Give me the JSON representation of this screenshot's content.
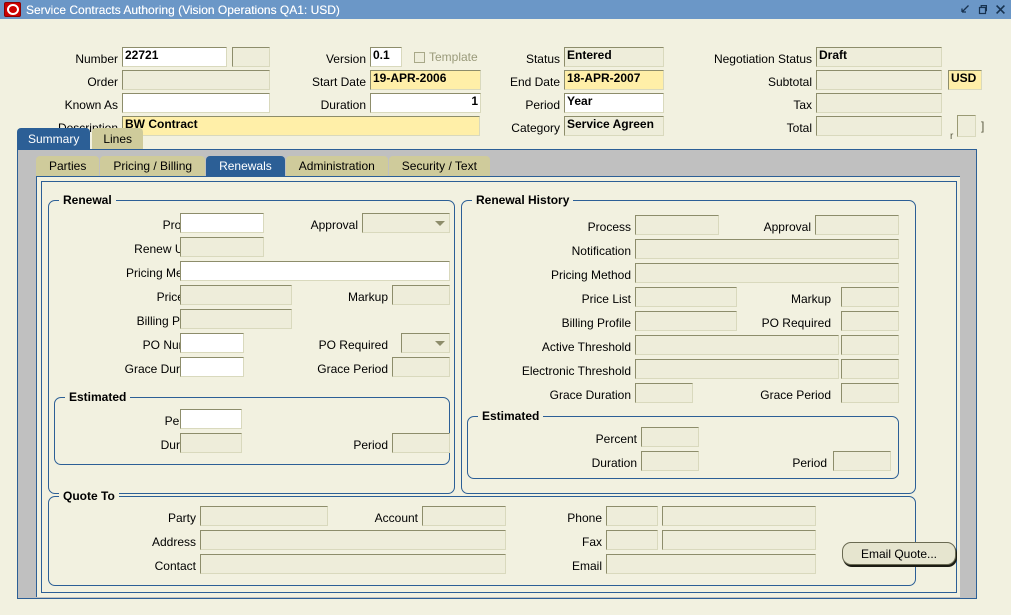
{
  "window": {
    "title": "Service Contracts Authoring (Vision Operations QA1: USD)",
    "logo_icon": "oracle-logo-icon",
    "controls": [
      {
        "name": "minimize-button",
        "icon": "minimize-icon"
      },
      {
        "name": "restore-button",
        "icon": "restore-icon"
      },
      {
        "name": "close-button",
        "icon": "close-icon"
      }
    ]
  },
  "header": {
    "number": {
      "label": "Number",
      "value": "22721"
    },
    "number_extra": {
      "label": "",
      "value": ""
    },
    "order": {
      "label": "Order",
      "value": ""
    },
    "known_as": {
      "label": "Known As",
      "value": ""
    },
    "description": {
      "label": "Description",
      "value": "BW Contract"
    },
    "version": {
      "label": "Version",
      "value": "0.1"
    },
    "template": {
      "label": "Template",
      "checked": false
    },
    "start_date": {
      "label": "Start Date",
      "value": "19-APR-2006"
    },
    "duration": {
      "label": "Duration",
      "value": "1"
    },
    "status": {
      "label": "Status",
      "value": "Entered"
    },
    "end_date": {
      "label": "End Date",
      "value": "18-APR-2007"
    },
    "period": {
      "label": "Period",
      "value": "Year"
    },
    "category": {
      "label": "Category",
      "value": "Service Agreen"
    },
    "negotiation_status": {
      "label": "Negotiation Status",
      "value": "Draft"
    },
    "subtotal": {
      "label": "Subtotal",
      "value": ""
    },
    "currency": {
      "label": "",
      "value": "USD"
    },
    "tax": {
      "label": "Tax",
      "value": ""
    },
    "total": {
      "label": "Total",
      "value": ""
    },
    "total_bracket_right": "]",
    "total_bracket_left": "r"
  },
  "tabs_primary": [
    {
      "label": "Summary",
      "selected": true
    },
    {
      "label": "Lines",
      "selected": false
    }
  ],
  "tabs_secondary": [
    {
      "label": "Parties",
      "selected": false
    },
    {
      "label": "Pricing / Billing",
      "selected": false
    },
    {
      "label": "Renewals",
      "selected": true
    },
    {
      "label": "Administration",
      "selected": false
    },
    {
      "label": "Security / Text",
      "selected": false
    }
  ],
  "renewal": {
    "title": "Renewal",
    "process": {
      "label": "Process",
      "value": ""
    },
    "approval": {
      "label": "Approval",
      "value": ""
    },
    "renew_up_to": {
      "label": "Renew Up To",
      "value": ""
    },
    "pricing_method": {
      "label": "Pricing Method",
      "value": ""
    },
    "price_list": {
      "label": "Price List",
      "value": ""
    },
    "markup": {
      "label": "Markup",
      "value": ""
    },
    "billing_profile": {
      "label": "Billing Profile",
      "value": ""
    },
    "po_number": {
      "label": "PO Number",
      "value": ""
    },
    "po_required": {
      "label": "PO Required",
      "value": ""
    },
    "grace_duration": {
      "label": "Grace Duration",
      "value": ""
    },
    "grace_period": {
      "label": "Grace Period",
      "value": ""
    },
    "estimated": {
      "title": "Estimated",
      "percent": {
        "label": "Percent",
        "value": ""
      },
      "duration": {
        "label": "Duration",
        "value": ""
      },
      "period": {
        "label": "Period",
        "value": ""
      }
    }
  },
  "renewal_history": {
    "title": "Renewal History",
    "process": {
      "label": "Process",
      "value": ""
    },
    "approval": {
      "label": "Approval",
      "value": ""
    },
    "notification": {
      "label": "Notification",
      "value": ""
    },
    "pricing_method": {
      "label": "Pricing Method",
      "value": ""
    },
    "price_list": {
      "label": "Price List",
      "value": ""
    },
    "markup": {
      "label": "Markup",
      "value": ""
    },
    "billing_profile": {
      "label": "Billing Profile",
      "value": ""
    },
    "po_required": {
      "label": "PO Required",
      "value": ""
    },
    "active_threshold": {
      "label": "Active Threshold",
      "value": "",
      "value2": ""
    },
    "electronic_threshold": {
      "label": "Electronic Threshold",
      "value": "",
      "value2": ""
    },
    "grace_duration": {
      "label": "Grace Duration",
      "value": ""
    },
    "grace_period": {
      "label": "Grace Period",
      "value": ""
    },
    "estimated": {
      "title": "Estimated",
      "percent": {
        "label": "Percent",
        "value": ""
      },
      "duration": {
        "label": "Duration",
        "value": ""
      },
      "period": {
        "label": "Period",
        "value": ""
      }
    }
  },
  "quote_to": {
    "title": "Quote To",
    "party": {
      "label": "Party",
      "value": ""
    },
    "account": {
      "label": "Account",
      "value": ""
    },
    "address": {
      "label": "Address",
      "value": ""
    },
    "contact": {
      "label": "Contact",
      "value": ""
    },
    "phone": {
      "label": "Phone",
      "value": "",
      "value2": ""
    },
    "fax": {
      "label": "Fax",
      "value": "",
      "value2": ""
    },
    "email": {
      "label": "Email",
      "value": ""
    },
    "email_quote_button": "Email Quote..."
  },
  "colors": {
    "titlebar": "#6b97c7",
    "tab_selected": "#2c5f96",
    "tab_unselected": "#cfcb9b",
    "canvas": "#f2f1e0",
    "required_field": "#ffefa8",
    "gray_frame": "#c0c0c0"
  }
}
